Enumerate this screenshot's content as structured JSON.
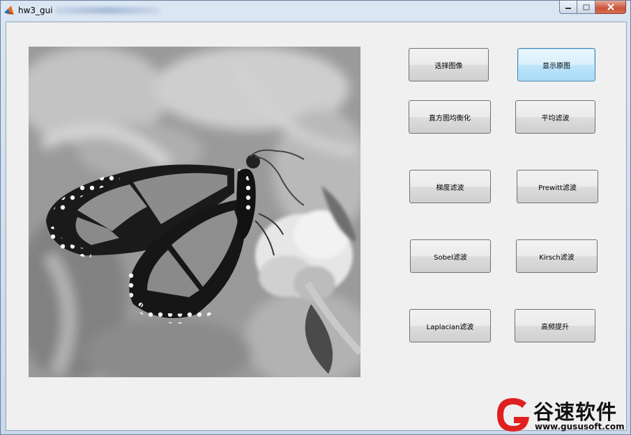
{
  "window": {
    "title": "hw3_gui"
  },
  "buttons": {
    "select_image": "选择图像",
    "show_original": "显示原图",
    "hist_equalize": "直方图均衡化",
    "mean_filter": "平均滤波",
    "gradient_filter": "梯度滤波",
    "prewitt_filter": "Prewitt滤波",
    "sobel_filter": "Sobel滤波",
    "kirsch_filter": "Kirsch滤波",
    "laplacian_filter": "Laplacian滤波",
    "high_boost": "高频提升"
  },
  "watermark": {
    "name": "谷速软件",
    "url": "www.gususoft.com"
  },
  "colors": {
    "client_bg": "#f0f0f0",
    "active_button": "#bee6fd",
    "watermark_red": "#e02020"
  }
}
